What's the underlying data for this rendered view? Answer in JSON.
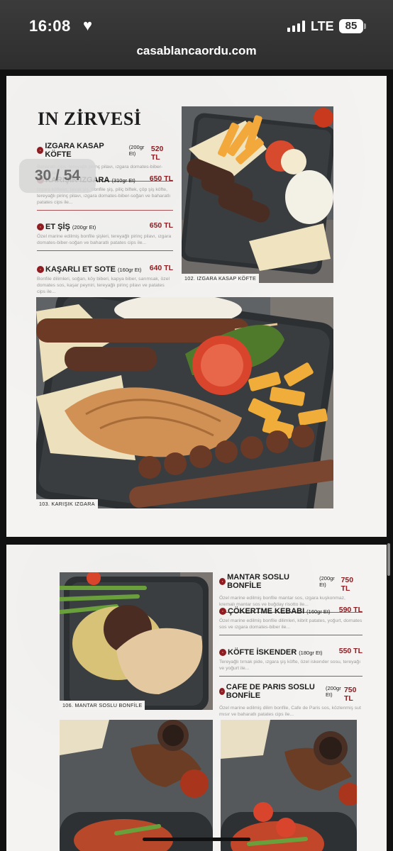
{
  "status_bar": {
    "time": "16:08",
    "heart_icon": "heart-icon",
    "network": "LTE",
    "battery": "85"
  },
  "browser": {
    "url": "casablancaordu.com"
  },
  "viewer": {
    "page_indicator": "30 / 54"
  },
  "page1": {
    "section_title": "IN ZİRVESİ",
    "items": [
      {
        "name": "IZGARA KASAP KÖFTE",
        "portion": "(200gr Et)",
        "price": "520 TL",
        "desc": "Baharatlı cips, tereyağlı pirinç pilavı, ızgara domates-biber-soğan ile..."
      },
      {
        "name": "KARIŞIK IZGARA",
        "portion": "(310gr Et)",
        "price": "650 TL",
        "desc": "Izgara köfteler, tavuk şiş, bonfile şiş, piliç biftek, çöp şiş köfte, tereyağlı pirinç pilavı, ızgara domates-biber-soğan ve baharatlı patates cips ile..."
      },
      {
        "name": "ET ŞİŞ",
        "portion": "(200gr Et)",
        "price": "650 TL",
        "desc": "Özel marine edilmiş bonfile şişleri, tereyağlı pirinç pilavı, ızgara domates-biber-soğan ve baharatlı patates cips ile..."
      },
      {
        "name": "KAŞARLI ET SOTE",
        "portion": "(160gr Et)",
        "price": "640 TL",
        "desc": "Bonfile dilimleri, soğan, köy biberi, kapya biber, sarımsak, özel domates sos, kaşar peyniri, tereyağlı pirinç pilavı ve patates cips ile..."
      }
    ],
    "photo_top_caption": "102. IZGARA KASAP KÖFTE",
    "photo_big_caption": "103. KARIŞIK IZGARA"
  },
  "page2": {
    "items": [
      {
        "name": "MANTAR SOSLU BONFİLE",
        "portion": "(200gr Et)",
        "price": "750 TL",
        "desc": "Özel marine edilmiş bonfile mantar sos, ızgara kuşkonmaz, kremalı mantar sos ve buğday risotto ile..."
      },
      {
        "name": "ÇÖKERTME KEBABI",
        "portion": "(160gr Et)",
        "price": "590 TL",
        "desc": "Özel marine edilmiş bonfile dilimleri, kibrit patates, yoğurt, domates sos ve ızgara domates-biber ile..."
      },
      {
        "name": "KÖFTE İSKENDER",
        "portion": "(180gr Et)",
        "price": "550 TL",
        "desc": "Tereyağlı tırnak pide, ızgara şiş köfte, özel iskender sosu, tereyağı ve yoğurt ile..."
      },
      {
        "name": "CAFE DE PARIS SOSLU BONFİLE",
        "portion": "(200gr Et)",
        "price": "750 TL",
        "desc": "Özel marine edilmiş dilim bonfile, Cafe de Paris sos, közlenmiş sut mısır ve baharatlı patates cips ile..."
      }
    ],
    "photo_caption": "106. MANTAR SOSLU BONFİLE"
  },
  "colors": {
    "accent": "#8e1c21",
    "page_bg": "#f4f3f1",
    "chrome_bg": "#333333"
  }
}
